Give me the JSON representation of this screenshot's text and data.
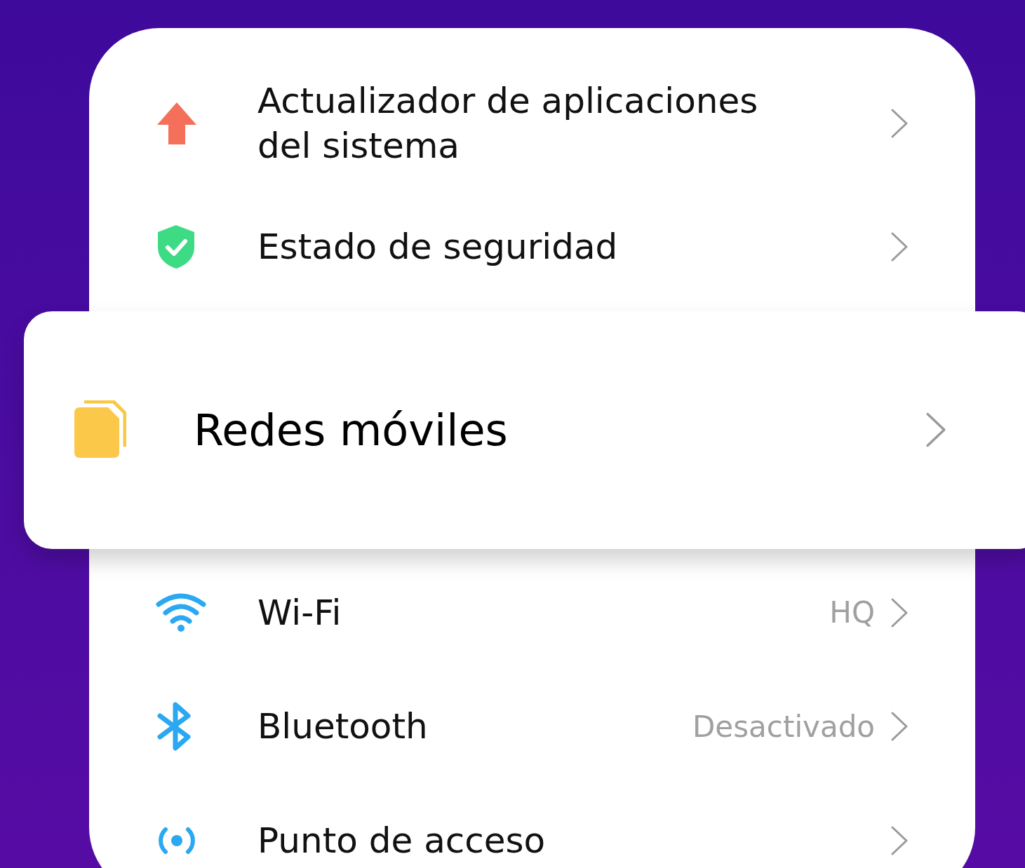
{
  "settings_rows": [
    {
      "label": "Actualizador de aplicaciones del sistema",
      "highlighted": false
    },
    {
      "label": "Estado de seguridad",
      "highlighted": false
    },
    {
      "label": "Redes móviles",
      "highlighted": true
    },
    {
      "label": "Wi-Fi",
      "value": "HQ",
      "highlighted": false
    },
    {
      "label": "Bluetooth",
      "value": "Desactivado",
      "highlighted": false
    },
    {
      "label": "Punto de acceso",
      "highlighted": false
    }
  ]
}
